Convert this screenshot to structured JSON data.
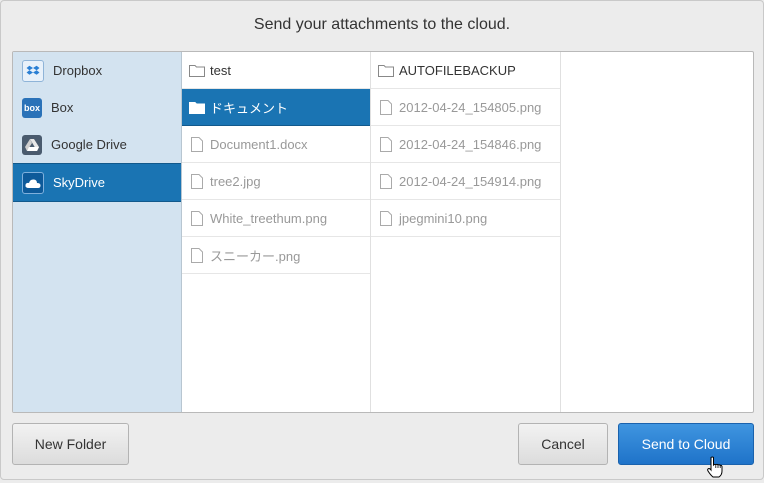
{
  "dialog": {
    "title": "Send your attachments to the cloud."
  },
  "services": [
    {
      "label": "Dropbox",
      "icon": "dropbox-icon",
      "selected": false
    },
    {
      "label": "Box",
      "icon": "box-icon",
      "selected": false
    },
    {
      "label": "Google Drive",
      "icon": "google-drive-icon",
      "selected": false
    },
    {
      "label": "SkyDrive",
      "icon": "skydrive-icon",
      "selected": true
    }
  ],
  "column1": [
    {
      "label": "test",
      "type": "folder",
      "selected": false
    },
    {
      "label": "ドキュメント",
      "type": "folder",
      "selected": true
    },
    {
      "label": "Document1.docx",
      "type": "file",
      "selected": false
    },
    {
      "label": "tree2.jpg",
      "type": "file",
      "selected": false
    },
    {
      "label": "White_treethum.png",
      "type": "file",
      "selected": false
    },
    {
      "label": "スニーカー.png",
      "type": "file",
      "selected": false
    }
  ],
  "column2": [
    {
      "label": "AUTOFILEBACKUP",
      "type": "folder",
      "selected": false
    },
    {
      "label": "2012-04-24_154805.png",
      "type": "file",
      "selected": false
    },
    {
      "label": "2012-04-24_154846.png",
      "type": "file",
      "selected": false
    },
    {
      "label": "2012-04-24_154914.png",
      "type": "file",
      "selected": false
    },
    {
      "label": "jpegmini10.png",
      "type": "file",
      "selected": false
    }
  ],
  "buttons": {
    "new_folder": "New Folder",
    "cancel": "Cancel",
    "send": "Send to Cloud"
  },
  "colors": {
    "selection": "#1a74b3",
    "sidebar": "#d3e3f0",
    "primary_button": "#2a7fd4"
  }
}
